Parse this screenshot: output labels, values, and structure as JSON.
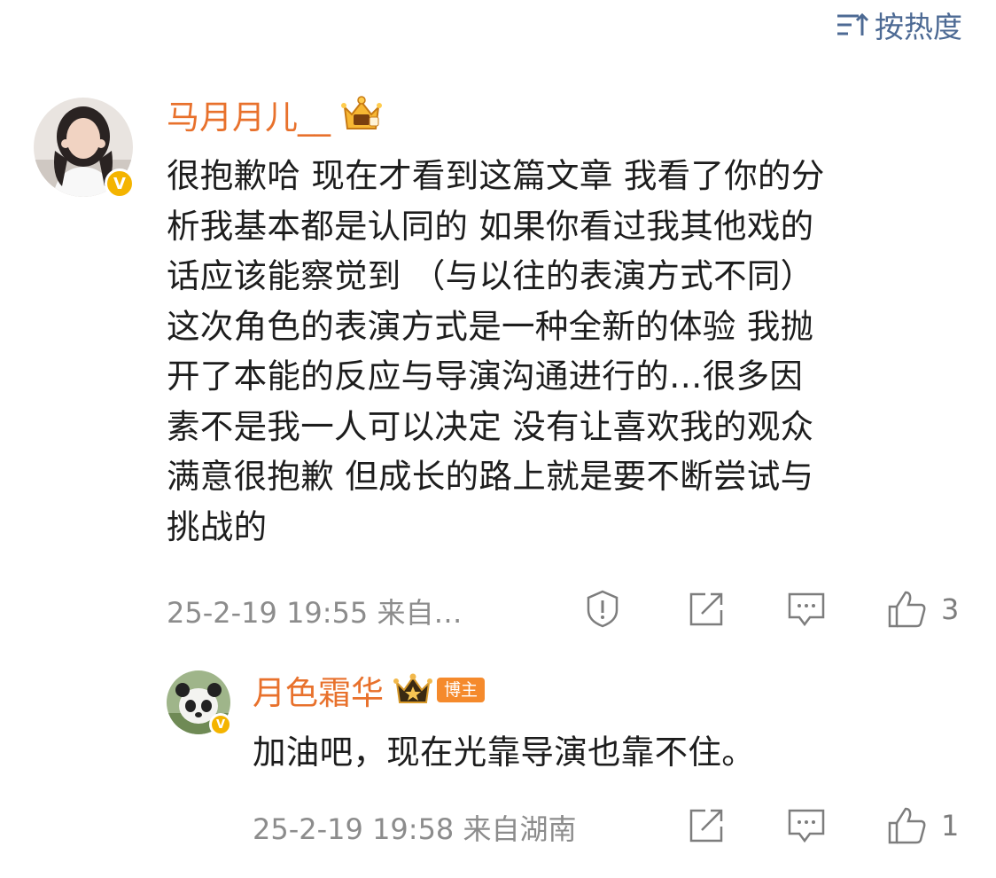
{
  "sort": {
    "label": "按热度",
    "icon": "sort-icon"
  },
  "comments": [
    {
      "author": "马月月儿__",
      "verified": "V",
      "lines": [
        "很抱歉哈 现在才看到这篇文章 我看了你的分",
        "析我基本都是认同的 如果你看过我其他戏的",
        "话应该能察觉到 （与以往的表演方式不同）",
        "这次角色的表演方式是一种全新的体验 我抛",
        "开了本能的反应与导演沟通进行的…很多因",
        "素不是我一人可以决定 没有让喜欢我的观众",
        "满意很抱歉 但成长的路上就是要不断尝试与",
        "挑战的"
      ],
      "meta": "25-2-19 19:55 来自…",
      "likes": "3",
      "colors": {
        "name": "#e8712c",
        "badge": "#f4b400"
      }
    },
    {
      "author": "月色霜华",
      "role_badge": "博主",
      "verified": "V",
      "text": "加油吧，现在光靠导演也靠不住。",
      "meta": "25-2-19 19:58 来自湖南",
      "likes": "1"
    }
  ]
}
